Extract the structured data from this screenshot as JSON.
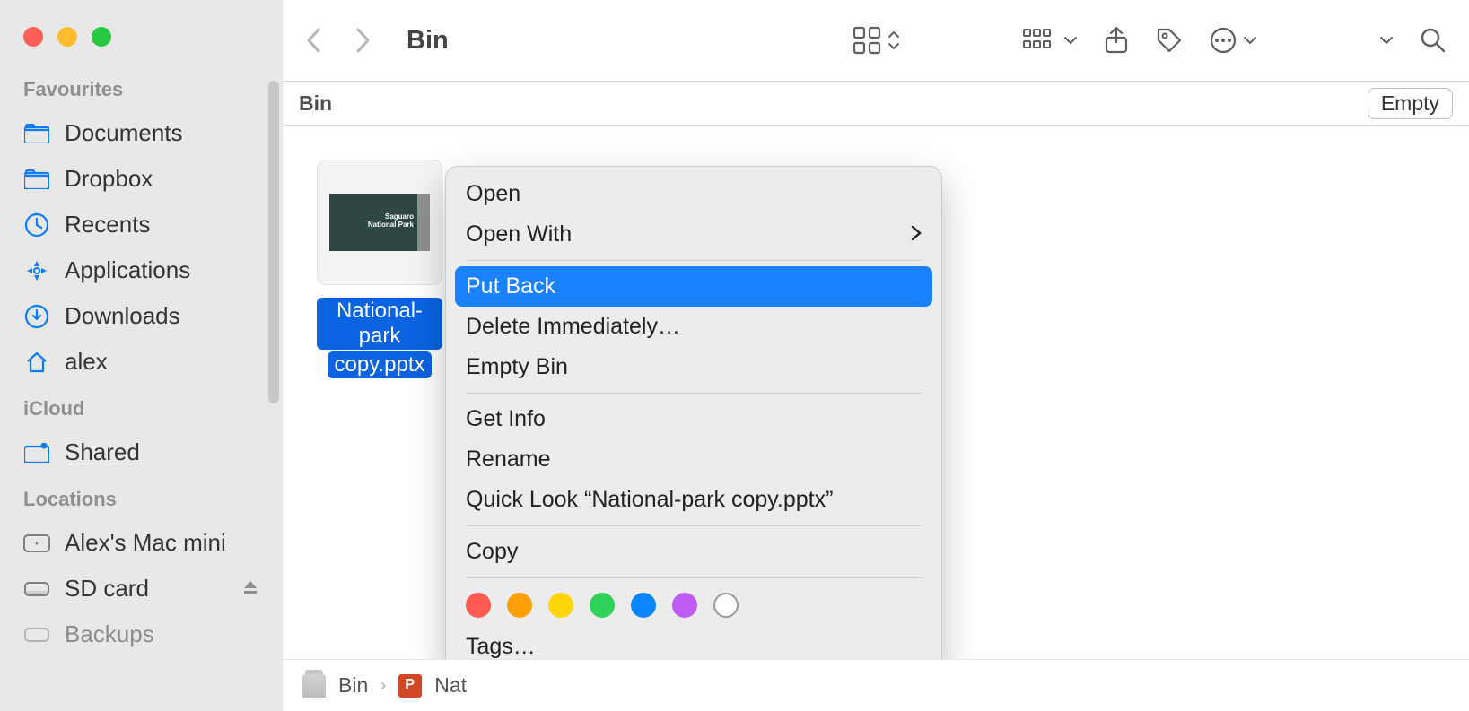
{
  "window": {
    "title": "Bin"
  },
  "sidebar": {
    "sections": {
      "favourites": {
        "label": "Favourites",
        "items": [
          "Documents",
          "Dropbox",
          "Recents",
          "Applications",
          "Downloads",
          "alex"
        ]
      },
      "icloud": {
        "label": "iCloud",
        "items": [
          "Shared"
        ]
      },
      "locations": {
        "label": "Locations",
        "items": [
          "Alex's Mac mini",
          "SD card",
          "Backups"
        ]
      }
    }
  },
  "location": {
    "title": "Bin",
    "empty_button": "Empty"
  },
  "file": {
    "name_line1": "National-park",
    "name_line2": "copy.pptx",
    "slide_label1": "Saguaro",
    "slide_label2": "National Park"
  },
  "context_menu": {
    "open": "Open",
    "open_with": "Open With",
    "put_back": "Put Back",
    "delete_immediately": "Delete Immediately…",
    "empty_bin": "Empty Bin",
    "get_info": "Get Info",
    "rename": "Rename",
    "quick_look": "Quick Look “National-park copy.pptx”",
    "copy": "Copy",
    "tags": "Tags…"
  },
  "pathbar": {
    "seg1": "Bin",
    "seg2_prefix": "Nat"
  },
  "colors": {
    "accent": "#0a7bff",
    "highlight": "#1a82ff",
    "selection": "#0a63e1"
  }
}
